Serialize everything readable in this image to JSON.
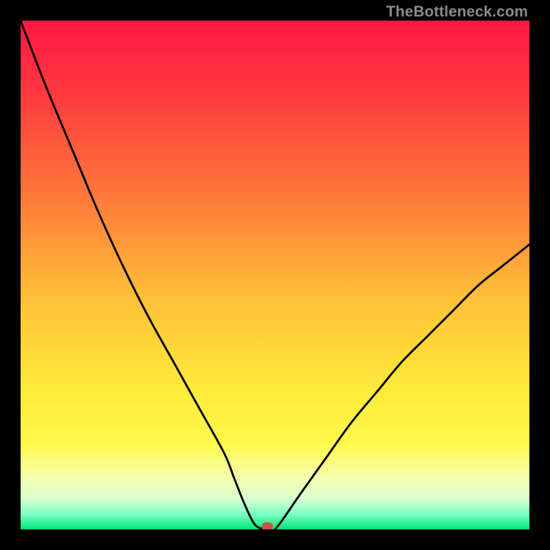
{
  "watermark": "TheBottleneck.com",
  "chart_data": {
    "type": "line",
    "title": "",
    "xlabel": "",
    "ylabel": "",
    "xlim": [
      0,
      100
    ],
    "ylim": [
      0,
      100
    ],
    "x": [
      0,
      5,
      10,
      15,
      20,
      25,
      30,
      35,
      40,
      42,
      44,
      46,
      48,
      50,
      55,
      60,
      65,
      70,
      75,
      80,
      85,
      90,
      95,
      100
    ],
    "y": [
      100,
      87,
      75,
      63,
      52,
      42,
      33,
      24,
      15,
      10,
      5,
      1,
      0,
      0,
      7,
      14,
      21,
      27,
      33,
      38,
      43,
      48,
      52,
      56
    ],
    "marker": {
      "x": 48.5,
      "y": 0
    },
    "background_gradient": {
      "stops": [
        {
          "offset": 0.0,
          "color": "#ff1744"
        },
        {
          "offset": 0.15,
          "color": "#ff3b3f"
        },
        {
          "offset": 0.35,
          "color": "#ff7a3a"
        },
        {
          "offset": 0.55,
          "color": "#ffc13a"
        },
        {
          "offset": 0.72,
          "color": "#ffe93a"
        },
        {
          "offset": 0.83,
          "color": "#fff94a"
        },
        {
          "offset": 0.9,
          "color": "#f5ffb0"
        },
        {
          "offset": 0.94,
          "color": "#d8ffcf"
        },
        {
          "offset": 0.97,
          "color": "#7dffc4"
        },
        {
          "offset": 1.0,
          "color": "#00e676"
        }
      ]
    }
  }
}
